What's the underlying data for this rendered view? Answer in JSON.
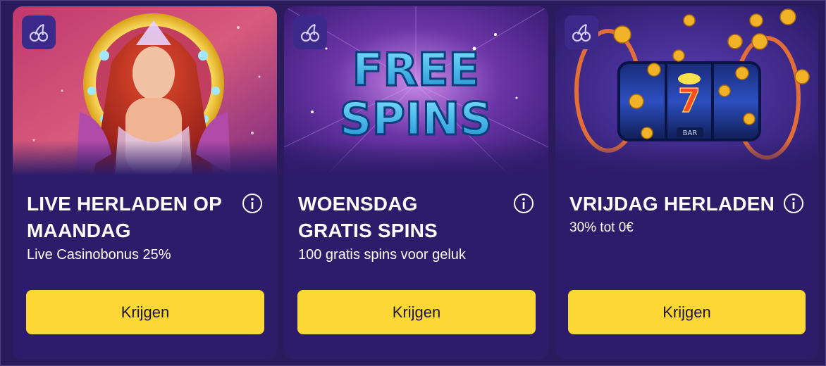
{
  "cards": [
    {
      "title": "LIVE HERLADEN OP MAANDAG",
      "subtitle": "Live Casinobonus 25%",
      "button_label": "Krijgen",
      "badge_icon": "cherries-icon",
      "info_icon": "info-icon",
      "image": "queen-slot-artwork"
    },
    {
      "title": "WOENSDAG GRATIS SPINS",
      "subtitle": "100 gratis spins voor geluk",
      "button_label": "Krijgen",
      "badge_icon": "cherries-icon",
      "info_icon": "info-icon",
      "image": "free-spins-artwork",
      "image_text_line1": "FREE",
      "image_text_line2": "SPINS"
    },
    {
      "title": "VRIJDAG HERLADEN",
      "subtitle": "30% tot 0€",
      "button_label": "Krijgen",
      "badge_icon": "cherries-icon",
      "info_icon": "info-icon",
      "image": "slot-machine-coins-artwork",
      "image_text_reel": "7",
      "image_text_bar": "BAR"
    }
  ],
  "colors": {
    "page_bg": "#2a1b5c",
    "card_bg": "#2d1c69",
    "badge_bg": "#3b2a8a",
    "button_bg": "#fdd835",
    "button_text": "#1b1435",
    "text": "#ffffff"
  }
}
